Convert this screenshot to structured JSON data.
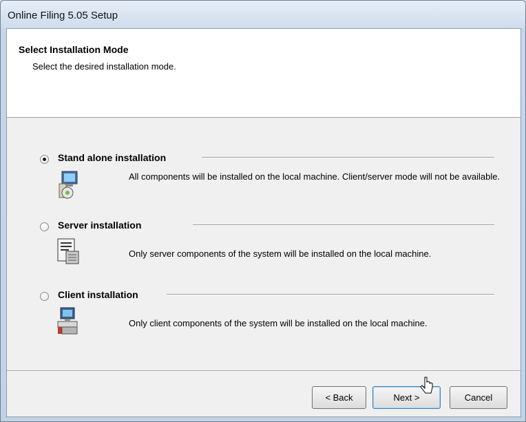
{
  "window": {
    "title": "Online Filing 5.05 Setup"
  },
  "header": {
    "title": "Select Installation Mode",
    "subtitle": "Select the desired installation mode."
  },
  "options": [
    {
      "label": "Stand alone installation",
      "description": "All components will be installed on the local machine. Client/server mode will not be available.",
      "checked": true,
      "icon": "standalone-computer-icon"
    },
    {
      "label": "Server installation",
      "description": "Only server components of the system will be installed on the local machine.",
      "checked": false,
      "icon": "server-document-icon"
    },
    {
      "label": "Client installation",
      "description": "Only client components of the system will be installed on the local machine.",
      "checked": false,
      "icon": "client-computer-icon"
    }
  ],
  "buttons": {
    "back": "< Back",
    "next": "Next >",
    "cancel": "Cancel"
  },
  "colors": {
    "background": "#f0f0f0",
    "header": "#ffffff",
    "focus_border": "#3c7fb1"
  }
}
